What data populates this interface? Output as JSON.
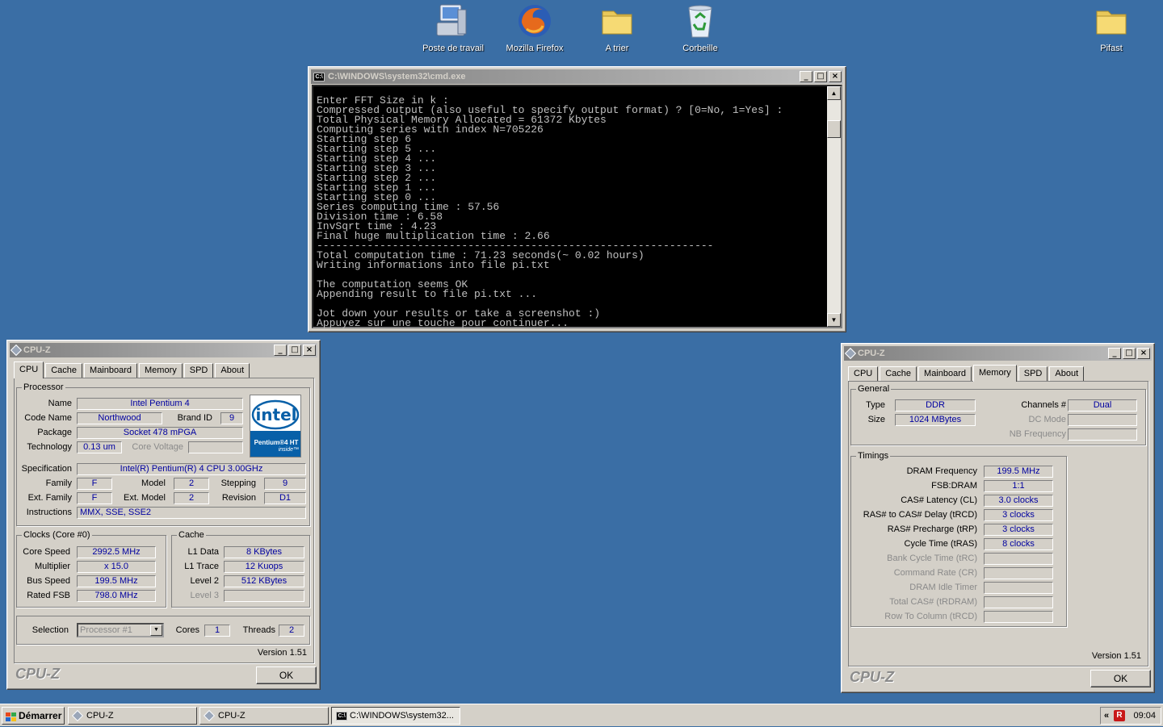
{
  "desktop": {
    "icons": [
      {
        "label": "Poste de travail",
        "icon": "computer-icon"
      },
      {
        "label": "Mozilla Firefox",
        "icon": "firefox-icon"
      },
      {
        "label": "A trier",
        "icon": "folder-icon"
      },
      {
        "label": "Corbeille",
        "icon": "recycle-bin-icon"
      },
      {
        "label": "Pifast",
        "icon": "folder-icon"
      }
    ]
  },
  "cmd": {
    "title": "C:\\WINDOWS\\system32\\cmd.exe",
    "lines": [
      "Enter FFT Size in k :",
      "Compressed output (also useful to specify output format) ? [0=No, 1=Yes] :",
      "Total Physical Memory Allocated = 61372 Kbytes",
      "Computing series with index N=705226",
      "Starting step 6",
      "Starting step 5 ...",
      "Starting step 4 ...",
      "Starting step 3 ...",
      "Starting step 2 ...",
      "Starting step 1 ...",
      "Starting step 0 ...",
      "Series computing time : 57.56",
      "Division time : 6.58",
      "InvSqrt time : 4.23",
      "Final huge multiplication time : 2.66",
      "---------------------------------------------------------------",
      "Total computation time : 71.23 seconds(~ 0.02 hours)",
      "Writing informations into file pi.txt",
      "",
      "The computation seems OK",
      "Appending result to file pi.txt ...",
      "",
      "Jot down your results or take a screenshot :)",
      "Appuyez sur une touche pour continuer..."
    ]
  },
  "cpuz1": {
    "title": "CPU-Z",
    "tabs": [
      "CPU",
      "Cache",
      "Mainboard",
      "Memory",
      "SPD",
      "About"
    ],
    "processor": {
      "group": "Processor",
      "name_label": "Name",
      "name": "Intel Pentium 4",
      "code_label": "Code Name",
      "code": "Northwood",
      "brand_label": "Brand ID",
      "brand": "9",
      "package_label": "Package",
      "package": "Socket 478 mPGA",
      "tech_label": "Technology",
      "tech": "0.13 um",
      "voltage_label": "Core Voltage",
      "voltage": "",
      "spec_label": "Specification",
      "spec": "Intel(R) Pentium(R) 4 CPU 3.00GHz",
      "family_label": "Family",
      "family": "F",
      "model_label": "Model",
      "model": "2",
      "stepping_label": "Stepping",
      "stepping": "9",
      "extfamily_label": "Ext. Family",
      "extfamily": "F",
      "extmodel_label": "Ext. Model",
      "extmodel": "2",
      "revision_label": "Revision",
      "revision": "D1",
      "instr_label": "Instructions",
      "instr": "MMX, SSE, SSE2"
    },
    "logo": {
      "word": "intel",
      "line1": "Pentium®4 HT",
      "line2": "inside™"
    },
    "clocks": {
      "group": "Clocks (Core #0)",
      "core_label": "Core Speed",
      "core": "2992.5 MHz",
      "mult_label": "Multiplier",
      "mult": "x 15.0",
      "bus_label": "Bus Speed",
      "bus": "199.5 MHz",
      "fsb_label": "Rated FSB",
      "fsb": "798.0 MHz"
    },
    "cache": {
      "group": "Cache",
      "l1d_label": "L1 Data",
      "l1d": "8 KBytes",
      "l1t_label": "L1 Trace",
      "l1t": "12 Kuops",
      "l2_label": "Level 2",
      "l2": "512 KBytes",
      "l3_label": "Level 3",
      "l3": ""
    },
    "selection_label": "Selection",
    "selection": "Processor #1",
    "cores_label": "Cores",
    "cores": "1",
    "threads_label": "Threads",
    "threads": "2",
    "version": "Version 1.51",
    "brand": "CPU-Z",
    "ok": "OK"
  },
  "cpuz2": {
    "title": "CPU-Z",
    "tabs": [
      "CPU",
      "Cache",
      "Mainboard",
      "Memory",
      "SPD",
      "About"
    ],
    "general": {
      "group": "General",
      "type_label": "Type",
      "type": "DDR",
      "size_label": "Size",
      "size": "1024 MBytes",
      "channels_label": "Channels #",
      "channels": "Dual",
      "dcmode_label": "DC Mode",
      "dcmode": "",
      "nbfreq_label": "NB Frequency",
      "nbfreq": ""
    },
    "timings": {
      "group": "Timings",
      "rows": [
        {
          "label": "DRAM Frequency",
          "value": "199.5 MHz",
          "dis": false
        },
        {
          "label": "FSB:DRAM",
          "value": "1:1",
          "dis": false
        },
        {
          "label": "CAS# Latency (CL)",
          "value": "3.0 clocks",
          "dis": false
        },
        {
          "label": "RAS# to CAS# Delay (tRCD)",
          "value": "3 clocks",
          "dis": false
        },
        {
          "label": "RAS# Precharge (tRP)",
          "value": "3 clocks",
          "dis": false
        },
        {
          "label": "Cycle Time (tRAS)",
          "value": "8 clocks",
          "dis": false
        },
        {
          "label": "Bank Cycle Time (tRC)",
          "value": "",
          "dis": true
        },
        {
          "label": "Command Rate (CR)",
          "value": "",
          "dis": true
        },
        {
          "label": "DRAM Idle Timer",
          "value": "",
          "dis": true
        },
        {
          "label": "Total CAS# (tRDRAM)",
          "value": "",
          "dis": true
        },
        {
          "label": "Row To Column (tRCD)",
          "value": "",
          "dis": true
        }
      ]
    },
    "version": "Version 1.51",
    "brand": "CPU-Z",
    "ok": "OK"
  },
  "taskbar": {
    "start": "Démarrer",
    "tasks": [
      "CPU-Z",
      "CPU-Z",
      "C:\\WINDOWS\\system32..."
    ],
    "clock": "09:04",
    "expand": "«"
  },
  "colors": {
    "desktop": "#3a6ea5",
    "title_active": "#0a246a",
    "value_text": "#0000a0"
  }
}
